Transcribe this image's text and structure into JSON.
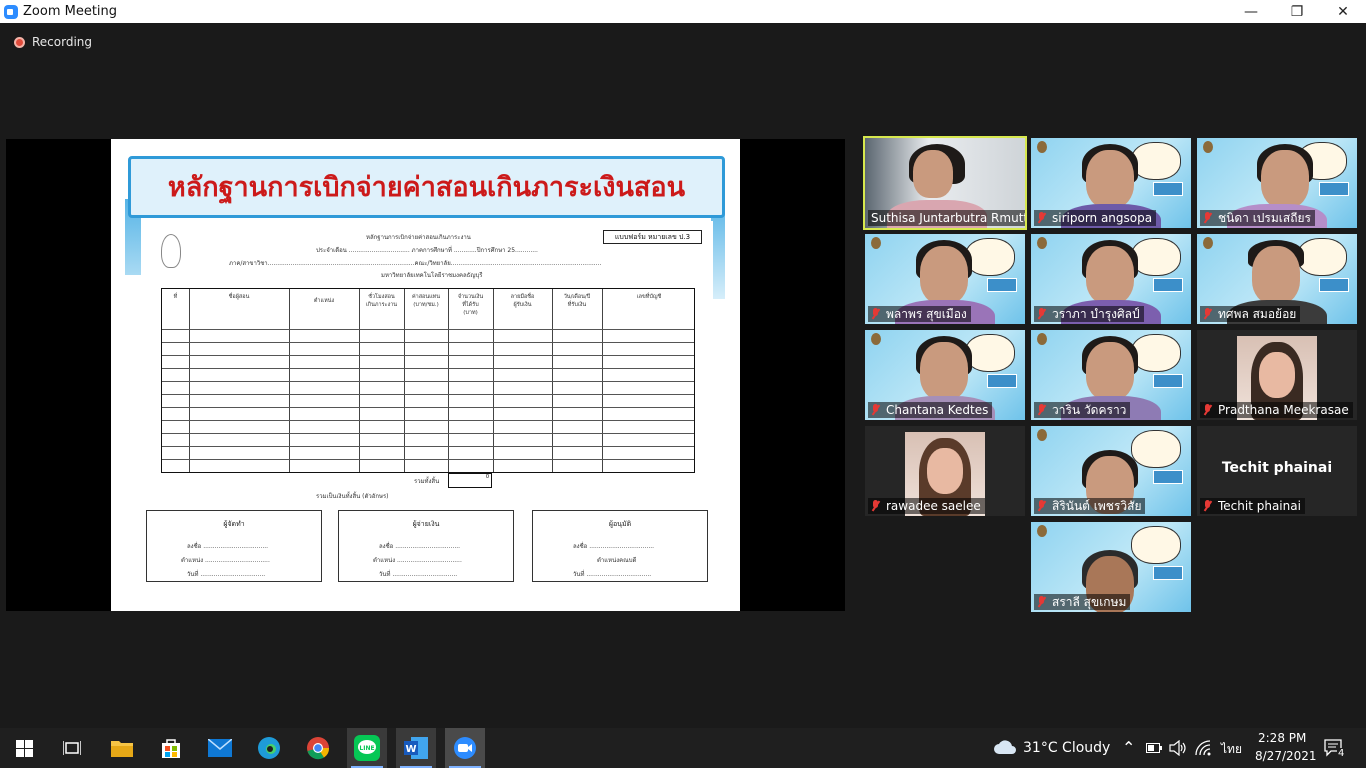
{
  "window": {
    "title": "Zoom Meeting",
    "minimize": "—",
    "maximize": "❐",
    "close": "✕"
  },
  "meeting": {
    "recording_label": "Recording"
  },
  "slide": {
    "title": "หลักฐานการเบิกจ่ายค่าสอนเกินภาระเงินสอน",
    "form_code": "แบบฟอร์ม หมายเลข ป.3",
    "header_lines": [
      "หลักฐานการเบิกจ่ายค่าสอนเกินภาระงาน",
      "ประจำเดือน ................................ ภาคการศึกษาที่ ............ปีการศึกษา 25............",
      "ภาค/สาขาวิชา.............................................................................คณะ/วิทยาลัย...............................................................................",
      "มหาวิทยาลัยเทคโนโลยีราชมงคลธัญบุรี"
    ],
    "table_headers": [
      "ที่",
      "ชื่อผู้สอน",
      "ตำแหน่ง",
      "ชั่วโมงสอน\nเกินภาระงาน",
      "ค่าสอนแทน\n(บาท/ชม.)",
      "จำนวนเงิน\nที่ได้รับ\n(บาท)",
      "ลายมือชื่อ\nผู้รับเงิน",
      "วัน/เดือน/ปี\nที่รับเงิน",
      "เลขที่บัญชี"
    ],
    "total_label": "รวมทั้งสิ้น",
    "total_value": "0",
    "total_words_label": "รวมเป็นเงินทั้งสิ้น (ตัวอักษร)",
    "signatures": [
      {
        "heading": "ผู้จัดทำ",
        "lines": [
          "ลงชื่อ ..................................",
          "ตำแหน่ง ..................................",
          "วันที่ .................................."
        ]
      },
      {
        "heading": "ผู้จ่ายเงิน",
        "lines": [
          "ลงชื่อ ..................................",
          "ตำแหน่ง ..................................",
          "วันที่ .................................."
        ]
      },
      {
        "heading": "ผู้อนุมัติ",
        "lines": [
          "ลงชื่อ ..................................",
          "ตำแหน่งคณบดี",
          "วันที่ .................................."
        ]
      }
    ]
  },
  "participants": [
    {
      "name": "Suthisa  Juntarbutra Rmutt",
      "muted": false,
      "video": "room"
    },
    {
      "name": "siriporn angsopa",
      "muted": true,
      "video": "bg"
    },
    {
      "name": "ชนิดา เปรมเสถียร",
      "muted": true,
      "video": "bg"
    },
    {
      "name": "พลาพร สุขเมือง",
      "muted": true,
      "video": "bg"
    },
    {
      "name": "วราภา บำรุงศิลป์",
      "muted": true,
      "video": "bg"
    },
    {
      "name": "ทศพล สมอย้อย",
      "muted": true,
      "video": "bg"
    },
    {
      "name": "Chantana Kedtes",
      "muted": true,
      "video": "bg"
    },
    {
      "name": "วาริน วัดคราว",
      "muted": true,
      "video": "bg"
    },
    {
      "name": "Pradthana Meekrasae",
      "muted": true,
      "video": "photo"
    },
    {
      "name": "rawadee saelee",
      "muted": true,
      "video": "photo"
    },
    {
      "name": "สิรินันต์ เพชรวิสัย",
      "muted": true,
      "video": "bg"
    },
    {
      "name": "Techit phainai",
      "muted": true,
      "video": "off",
      "display_name": "Techit phainai"
    },
    {
      "name": "สราลี สุขเกษม",
      "muted": true,
      "video": "bg"
    }
  ],
  "taskbar": {
    "weather": "31°C  Cloudy",
    "ime": "ไทย",
    "time": "2:28 PM",
    "date": "8/27/2021",
    "notifications": "4",
    "apps": [
      "start-icon",
      "task-view-icon",
      "file-explorer-icon",
      "store-icon",
      "mail-icon",
      "edge-icon",
      "chrome-icon",
      "line-icon",
      "word-icon",
      "zoom-icon"
    ]
  },
  "colors": {
    "active_speaker": "#d7e84e",
    "slide_title": "#cc1a1a",
    "banner_border": "#2f9ad8",
    "zoom_blue": "#2d8cff"
  }
}
